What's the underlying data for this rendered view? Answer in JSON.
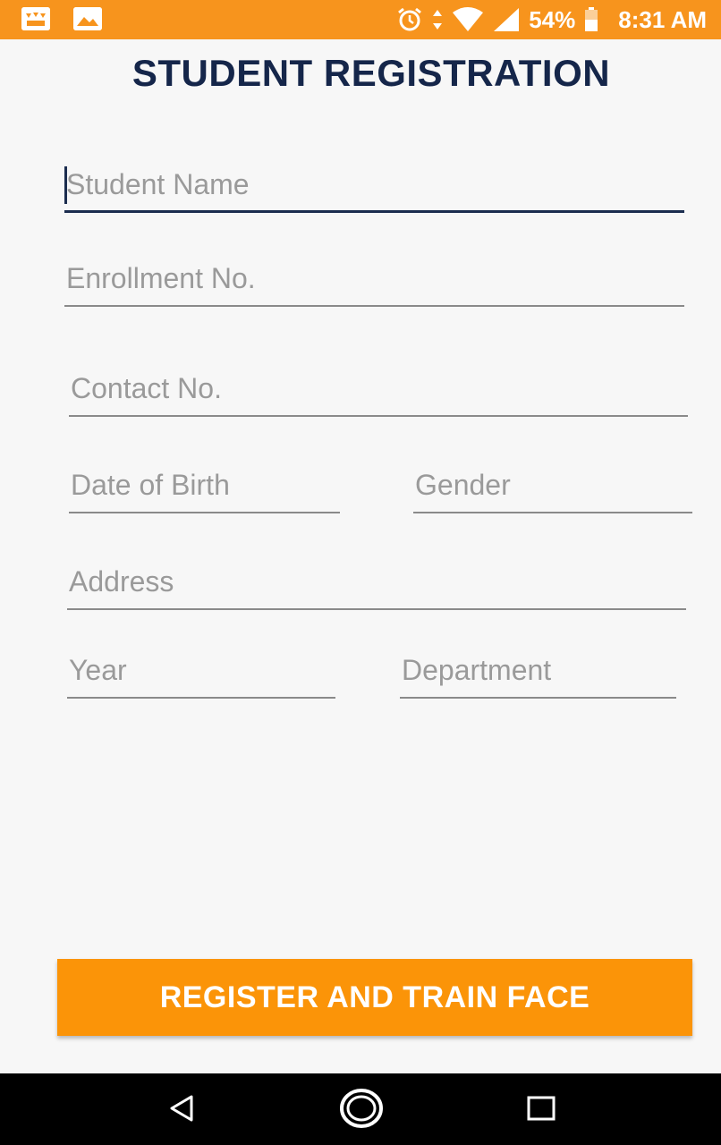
{
  "status_bar": {
    "battery": "54%",
    "time": "8:31 AM",
    "background_color": "#f7941d",
    "icons": [
      "notification-app-icon",
      "image-icon",
      "alarm-icon",
      "data-arrows-icon",
      "wifi-icon",
      "signal-icon",
      "battery-icon"
    ]
  },
  "page": {
    "title": "STUDENT REGISTRATION",
    "title_color": "#15264a"
  },
  "form": {
    "student_name": {
      "placeholder": "Student Name",
      "value": ""
    },
    "enrollment_no": {
      "placeholder": "Enrollment No.",
      "value": ""
    },
    "contact_no": {
      "placeholder": "Contact No.",
      "value": ""
    },
    "date_of_birth": {
      "placeholder": "Date of Birth",
      "value": ""
    },
    "gender": {
      "placeholder": "Gender",
      "value": ""
    },
    "address": {
      "placeholder": "Address",
      "value": ""
    },
    "year": {
      "placeholder": "Year",
      "value": ""
    },
    "department": {
      "placeholder": "Department",
      "value": ""
    }
  },
  "actions": {
    "register_label": "REGISTER AND TRAIN FACE",
    "register_color": "#fb9408"
  },
  "navigation": {
    "icons": [
      "back-icon",
      "home-icon",
      "recents-icon"
    ]
  }
}
